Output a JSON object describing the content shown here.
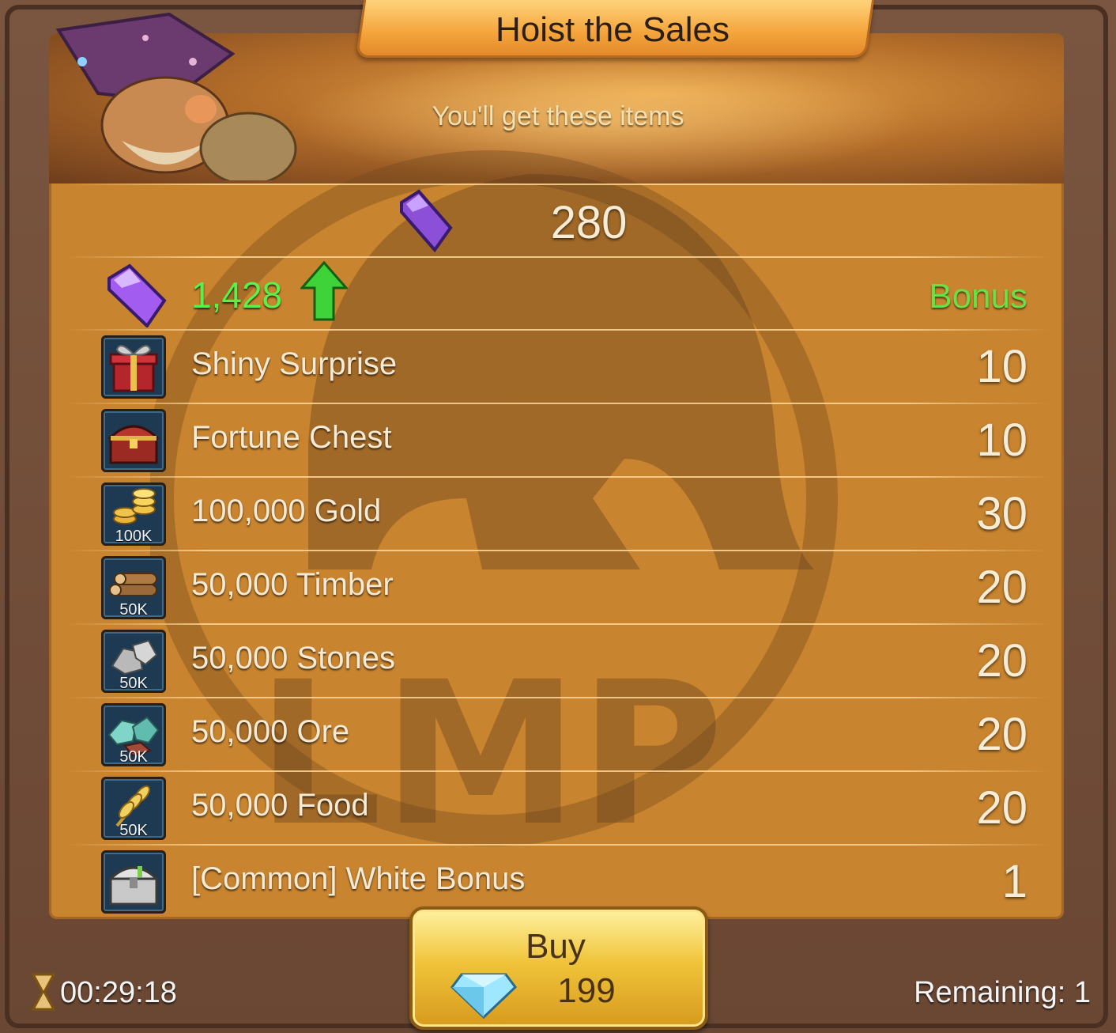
{
  "header": {
    "title": "Hoist the Sales",
    "subtitle": "You'll get these items"
  },
  "price_gems": "280",
  "bonus_gems": {
    "value": "1,428",
    "label": "Bonus"
  },
  "items": [
    {
      "name": "Shiny Surprise",
      "count": "10",
      "qty": "",
      "icon": "gift-box-icon"
    },
    {
      "name": "Fortune Chest",
      "count": "10",
      "qty": "",
      "icon": "treasure-chest-icon"
    },
    {
      "name": "100,000 Gold",
      "count": "30",
      "qty": "100K",
      "icon": "gold-coins-icon"
    },
    {
      "name": "50,000 Timber",
      "count": "20",
      "qty": "50K",
      "icon": "timber-logs-icon"
    },
    {
      "name": "50,000 Stones",
      "count": "20",
      "qty": "50K",
      "icon": "stones-icon"
    },
    {
      "name": "50,000 Ore",
      "count": "20",
      "qty": "50K",
      "icon": "ore-icon"
    },
    {
      "name": "50,000 Food",
      "count": "20",
      "qty": "50K",
      "icon": "wheat-icon"
    },
    {
      "name": "[Common] White Bonus",
      "count": "1",
      "qty": "",
      "icon": "silver-chest-icon"
    }
  ],
  "buy": {
    "label": "Buy",
    "price": "199"
  },
  "footer": {
    "timer": "00:29:18",
    "remaining": "Remaining: 1"
  },
  "watermark": "LMP",
  "colors": {
    "panel": "#c8842f",
    "frame": "#6b4a35",
    "bonus_green": "#5bf04a",
    "button_gold": "#f0c43a"
  }
}
